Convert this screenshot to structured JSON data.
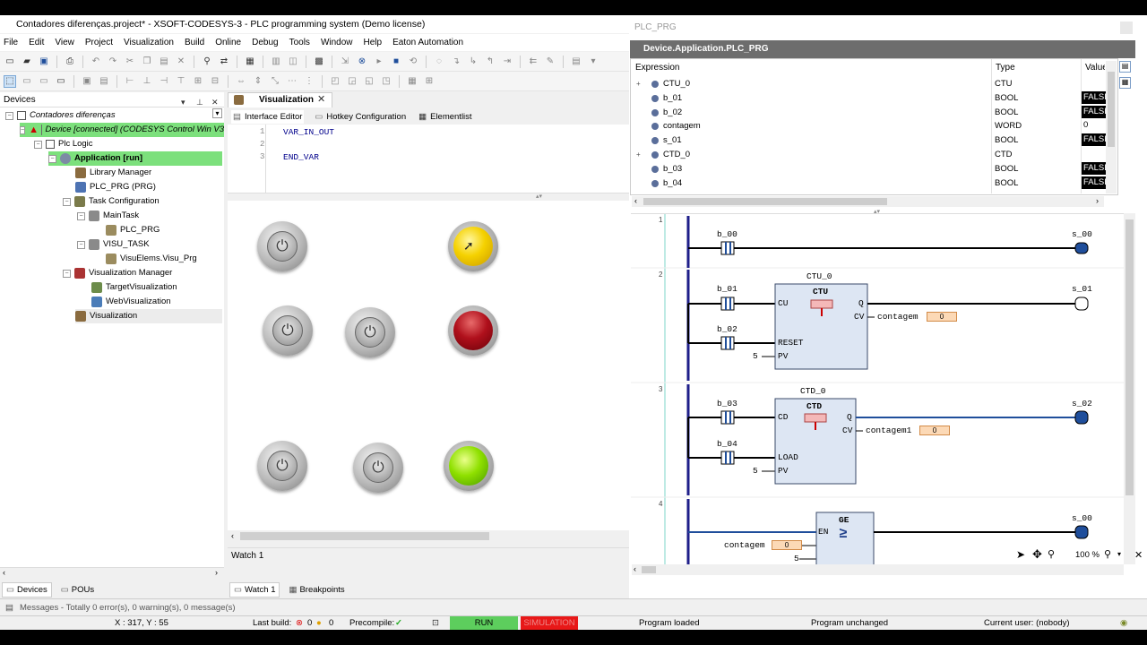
{
  "window": {
    "title": "Contadores diferenças.project* - XSOFT-CODESYS-3 - PLC programming system (Demo license)"
  },
  "menu": [
    "File",
    "Edit",
    "View",
    "Project",
    "Visualization",
    "Build",
    "Online",
    "Debug",
    "Tools",
    "Window",
    "Help",
    "Eaton Automation"
  ],
  "devices": {
    "title": "Devices",
    "tree": [
      {
        "label": "Contadores diferenças",
        "italic": true
      },
      {
        "label": "Device [connected] (CODESYS Control Win V3",
        "italic": true
      },
      {
        "label": "Plc Logic"
      },
      {
        "label": "Application [run]",
        "bold": true
      },
      {
        "label": "Library Manager"
      },
      {
        "label": "PLC_PRG (PRG)"
      },
      {
        "label": "Task Configuration"
      },
      {
        "label": "MainTask"
      },
      {
        "label": "PLC_PRG"
      },
      {
        "label": "VISU_TASK"
      },
      {
        "label": "VisuElems.Visu_Prg"
      },
      {
        "label": "Visualization Manager"
      },
      {
        "label": "TargetVisualization"
      },
      {
        "label": "WebVisualization"
      },
      {
        "label": "Visualization"
      }
    ],
    "tabs": [
      "Devices",
      "POUs"
    ]
  },
  "editor": {
    "tab": "Visualization",
    "subtabs": [
      "Interface Editor",
      "Hotkey Configuration",
      "Elementlist"
    ],
    "code": [
      {
        "ln": "1",
        "text": "VAR_IN_OUT"
      },
      {
        "ln": "2",
        "text": ""
      },
      {
        "ln": "3",
        "text": "END_VAR"
      }
    ]
  },
  "watch": {
    "title": "Watch 1",
    "tabs": [
      "Watch 1",
      "Breakpoints"
    ]
  },
  "messages": "Messages - Totally 0 error(s), 0 warning(s), 0 message(s)",
  "status": {
    "coords": "X : 317, Y : 55",
    "last_build_label": "Last build:",
    "errors": "0",
    "warnings": "0",
    "precompile_label": "Precompile:",
    "run": "RUN",
    "simulation": "SIMULATION",
    "program_loaded": "Program loaded",
    "program_unchanged": "Program unchanged",
    "current_user": "Current user: (nobody)"
  },
  "right_window": {
    "title": "PLC_PRG"
  },
  "monitor": {
    "title": "Device.Application.PLC_PRG",
    "columns": {
      "expression": "Expression",
      "type": "Type",
      "value": "Value"
    },
    "rows": [
      {
        "expandable": true,
        "name": "CTU_0",
        "type": "CTU",
        "value": ""
      },
      {
        "expandable": false,
        "name": "b_01",
        "type": "BOOL",
        "value": "FALSE"
      },
      {
        "expandable": false,
        "name": "b_02",
        "type": "BOOL",
        "value": "FALSE"
      },
      {
        "expandable": false,
        "name": "contagem",
        "type": "WORD",
        "value": "0"
      },
      {
        "expandable": false,
        "name": "s_01",
        "type": "BOOL",
        "value": "FALSE"
      },
      {
        "expandable": true,
        "name": "CTD_0",
        "type": "CTD",
        "value": ""
      },
      {
        "expandable": false,
        "name": "b_03",
        "type": "BOOL",
        "value": "FALSE"
      },
      {
        "expandable": false,
        "name": "b_04",
        "type": "BOOL",
        "value": "FALSE"
      }
    ]
  },
  "ladder": {
    "rungs": [
      "1",
      "2",
      "3",
      "4"
    ],
    "r1": {
      "contact": "b_00",
      "coil": "s_00"
    },
    "r2": {
      "instance": "CTU_0",
      "fb": "CTU",
      "in1": "b_01",
      "in2": "b_02",
      "pin_cu": "CU",
      "pin_reset": "RESET",
      "pin_pv": "PV",
      "pin_q": "Q",
      "pin_cv": "CV",
      "pv": "5",
      "cv_var": "contagem",
      "cv_val": "0",
      "coil": "s_01"
    },
    "r3": {
      "instance": "CTD_0",
      "fb": "CTD",
      "in1": "b_03",
      "in2": "b_04",
      "pin_cd": "CD",
      "pin_load": "LOAD",
      "pin_pv": "PV",
      "pin_q": "Q",
      "pin_cv": "CV",
      "pv": "5",
      "cv_var": "contagem1",
      "cv_val": "0",
      "coil": "s_02"
    },
    "r4": {
      "fb": "GE",
      "symbol": "≥",
      "pin_en": "EN",
      "in1_var": "contagem",
      "in1_val": "0",
      "in2": "5",
      "coil": "s_00"
    }
  },
  "zoom": "100 %",
  "colors": {
    "run": "#5dce5d",
    "simulation": "#e81818",
    "monitor_header": "#6d6d6d",
    "lamp_yellow": "#f5d100",
    "lamp_red": "#b0101c",
    "lamp_green": "#8fe000",
    "connected_green": "#7ce07c"
  }
}
